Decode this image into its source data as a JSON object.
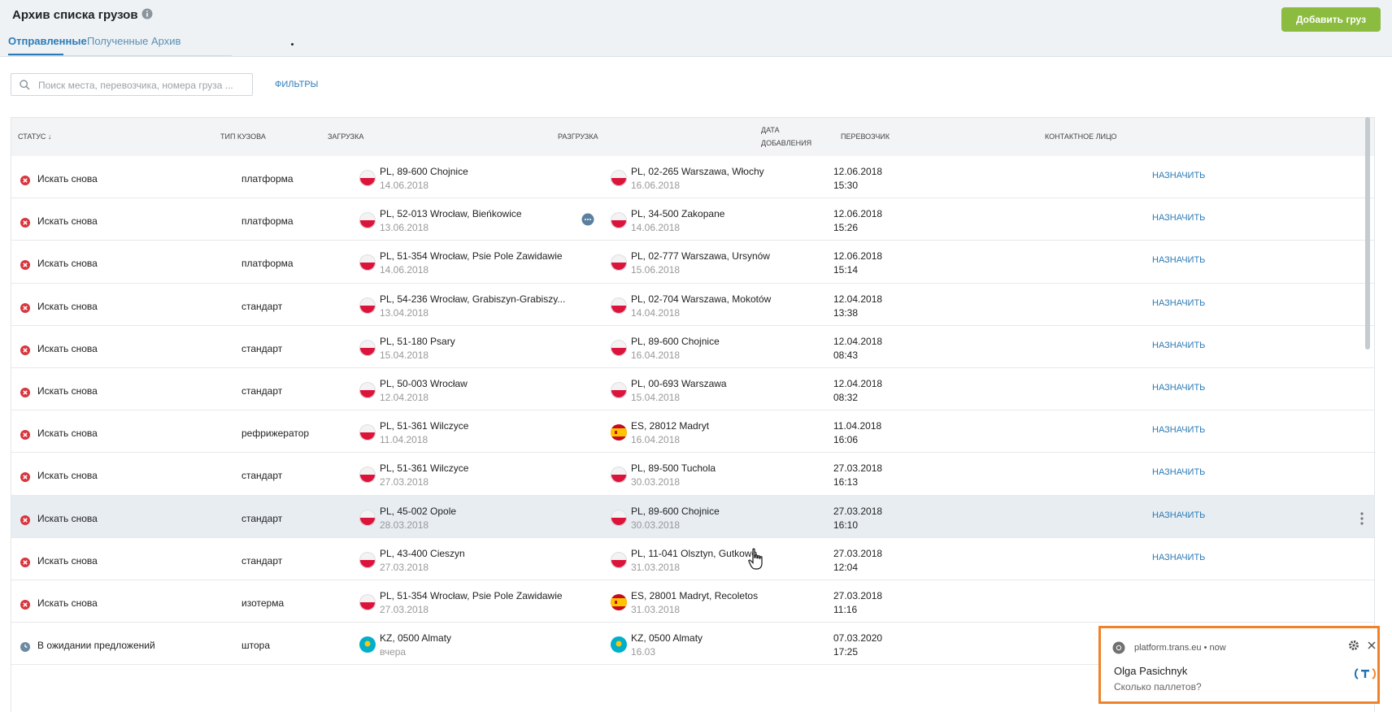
{
  "header": {
    "title": "Архив списка грузов",
    "add_button": "Добавить груз",
    "tabs": [
      {
        "label": "Отправленные",
        "active": true
      },
      {
        "label": "Полученные",
        "active": false
      },
      {
        "label": "Архив",
        "active": false
      }
    ]
  },
  "toolbar": {
    "search_placeholder": "Поиск места, перевозчика, номера груза ...",
    "filters_label": "ФИЛЬТРЫ"
  },
  "table": {
    "columns": {
      "status": "СТАТУС ↓",
      "body_type": "ТИП КУЗОВА",
      "loading": "ЗАГРУЗКА",
      "unloading": "РАЗГРУЗКА",
      "date_added_1": "ДАТА",
      "date_added_2": "ДОБАВЛЕНИЯ",
      "carrier": "ПЕРЕВОЗЧИК",
      "contact": "КОНТАКТНОЕ ЛИЦО"
    },
    "assign_label": "НАЗНАЧИТЬ",
    "rows": [
      {
        "status": "Искать снова",
        "status_type": "cancelled",
        "body_type": "платформа",
        "load_country": "pl",
        "load_place": "PL, 89-600 Chojnice",
        "load_date": "14.06.2018",
        "unload_country": "pl",
        "unload_place": "PL, 02-265 Warszawa, Włochy",
        "unload_date": "16.06.2018",
        "added_date": "12.06.2018",
        "added_time": "15:30",
        "assign": "НАЗНАЧИТЬ"
      },
      {
        "status": "Искать снова",
        "status_type": "cancelled",
        "body_type": "платформа",
        "load_country": "pl",
        "load_place": "PL, 52-013 Wrocław, Bieńkowice",
        "load_date": "13.06.2018",
        "unload_country": "pl",
        "unload_place": "PL, 34-500 Zakopane",
        "unload_date": "14.06.2018",
        "added_date": "12.06.2018",
        "added_time": "15:26",
        "assign": "НАЗНАЧИТЬ",
        "has_chat": true
      },
      {
        "status": "Искать снова",
        "status_type": "cancelled",
        "body_type": "платформа",
        "load_country": "pl",
        "load_place": "PL, 51-354 Wrocław, Psie Pole Zawidawie",
        "load_date": "14.06.2018",
        "unload_country": "pl",
        "unload_place": "PL, 02-777 Warszawa, Ursynów",
        "unload_date": "15.06.2018",
        "added_date": "12.06.2018",
        "added_time": "15:14",
        "assign": "НАЗНАЧИТЬ"
      },
      {
        "status": "Искать снова",
        "status_type": "cancelled",
        "body_type": "стандарт",
        "load_country": "pl",
        "load_place": "PL, 54-236 Wrocław, Grabiszyn-Grabiszy...",
        "load_date": "13.04.2018",
        "unload_country": "pl",
        "unload_place": "PL, 02-704 Warszawa, Mokotów",
        "unload_date": "14.04.2018",
        "added_date": "12.04.2018",
        "added_time": "13:38",
        "assign": "НАЗНАЧИТЬ"
      },
      {
        "status": "Искать снова",
        "status_type": "cancelled",
        "body_type": "стандарт",
        "load_country": "pl",
        "load_place": "PL, 51-180 Psary",
        "load_date": "15.04.2018",
        "unload_country": "pl",
        "unload_place": "PL, 89-600 Chojnice",
        "unload_date": "16.04.2018",
        "added_date": "12.04.2018",
        "added_time": "08:43",
        "assign": "НАЗНАЧИТЬ"
      },
      {
        "status": "Искать снова",
        "status_type": "cancelled",
        "body_type": "стандарт",
        "load_country": "pl",
        "load_place": "PL, 50-003 Wrocław",
        "load_date": "12.04.2018",
        "unload_country": "pl",
        "unload_place": "PL, 00-693 Warszawa",
        "unload_date": "15.04.2018",
        "added_date": "12.04.2018",
        "added_time": "08:32",
        "assign": "НАЗНАЧИТЬ"
      },
      {
        "status": "Искать снова",
        "status_type": "cancelled",
        "body_type": "рефрижератор",
        "load_country": "pl",
        "load_place": "PL, 51-361 Wilczyce",
        "load_date": "11.04.2018",
        "unload_country": "es",
        "unload_place": "ES, 28012 Madryt",
        "unload_date": "16.04.2018",
        "added_date": "11.04.2018",
        "added_time": "16:06",
        "assign": "НАЗНАЧИТЬ"
      },
      {
        "status": "Искать снова",
        "status_type": "cancelled",
        "body_type": "стандарт",
        "load_country": "pl",
        "load_place": "PL, 51-361 Wilczyce",
        "load_date": "27.03.2018",
        "unload_country": "pl",
        "unload_place": "PL, 89-500 Tuchola",
        "unload_date": "30.03.2018",
        "added_date": "27.03.2018",
        "added_time": "16:13",
        "assign": "НАЗНАЧИТЬ"
      },
      {
        "status": "Искать снова",
        "status_type": "cancelled",
        "body_type": "стандарт",
        "load_country": "pl",
        "load_place": "PL, 45-002 Opole",
        "load_date": "28.03.2018",
        "unload_country": "pl",
        "unload_place": "PL, 89-600 Chojnice",
        "unload_date": "30.03.2018",
        "added_date": "27.03.2018",
        "added_time": "16:10",
        "assign": "НАЗНАЧИТЬ",
        "highlighted": true
      },
      {
        "status": "Искать снова",
        "status_type": "cancelled",
        "body_type": "стандарт",
        "load_country": "pl",
        "load_place": "PL, 43-400 Cieszyn",
        "load_date": "27.03.2018",
        "unload_country": "pl",
        "unload_place": "PL, 11-041 Olsztyn, Gutkowo",
        "unload_date": "31.03.2018",
        "added_date": "27.03.2018",
        "added_time": "12:04",
        "assign": "НАЗНАЧИТЬ"
      },
      {
        "status": "Искать снова",
        "status_type": "cancelled",
        "body_type": "изотерма",
        "load_country": "pl",
        "load_place": "PL, 51-354 Wrocław, Psie Pole Zawidawie",
        "load_date": "27.03.2018",
        "unload_country": "es",
        "unload_place": "ES, 28001 Madryt, Recoletos",
        "unload_date": "31.03.2018",
        "added_date": "27.03.2018",
        "added_time": "11:16",
        "assign": ""
      },
      {
        "status": "В ожидании предложений",
        "status_type": "waiting",
        "body_type": "штора",
        "load_country": "kz",
        "load_place": "KZ, 0500 Almaty",
        "load_date": "вчера",
        "unload_country": "kz",
        "unload_place": "KZ, 0500 Almaty",
        "unload_date": "16.03",
        "added_date": "07.03.2020",
        "added_time": "17:25",
        "assign": ""
      }
    ]
  },
  "notification": {
    "source": "platform.trans.eu",
    "separator": "•",
    "time": "now",
    "sender": "Olga Pasichnyk",
    "message": "Сколько паллетов?"
  },
  "colors": {
    "accent": "#2c7bb6",
    "add_button": "#8bbb3f",
    "status_cancelled": "#d9363e",
    "status_waiting": "#6d8aa3",
    "notification_border": "#f0832a"
  },
  "icons": {
    "info": "info-icon",
    "search": "search-icon",
    "cancelled": "x-circle-icon",
    "waiting": "clock-icon",
    "chat": "chat-bubble-icon",
    "more": "kebab-menu-icon",
    "chrome": "chrome-icon",
    "gear": "gear-icon",
    "close": "close-icon",
    "brand": "trans-eu-logo-icon"
  }
}
